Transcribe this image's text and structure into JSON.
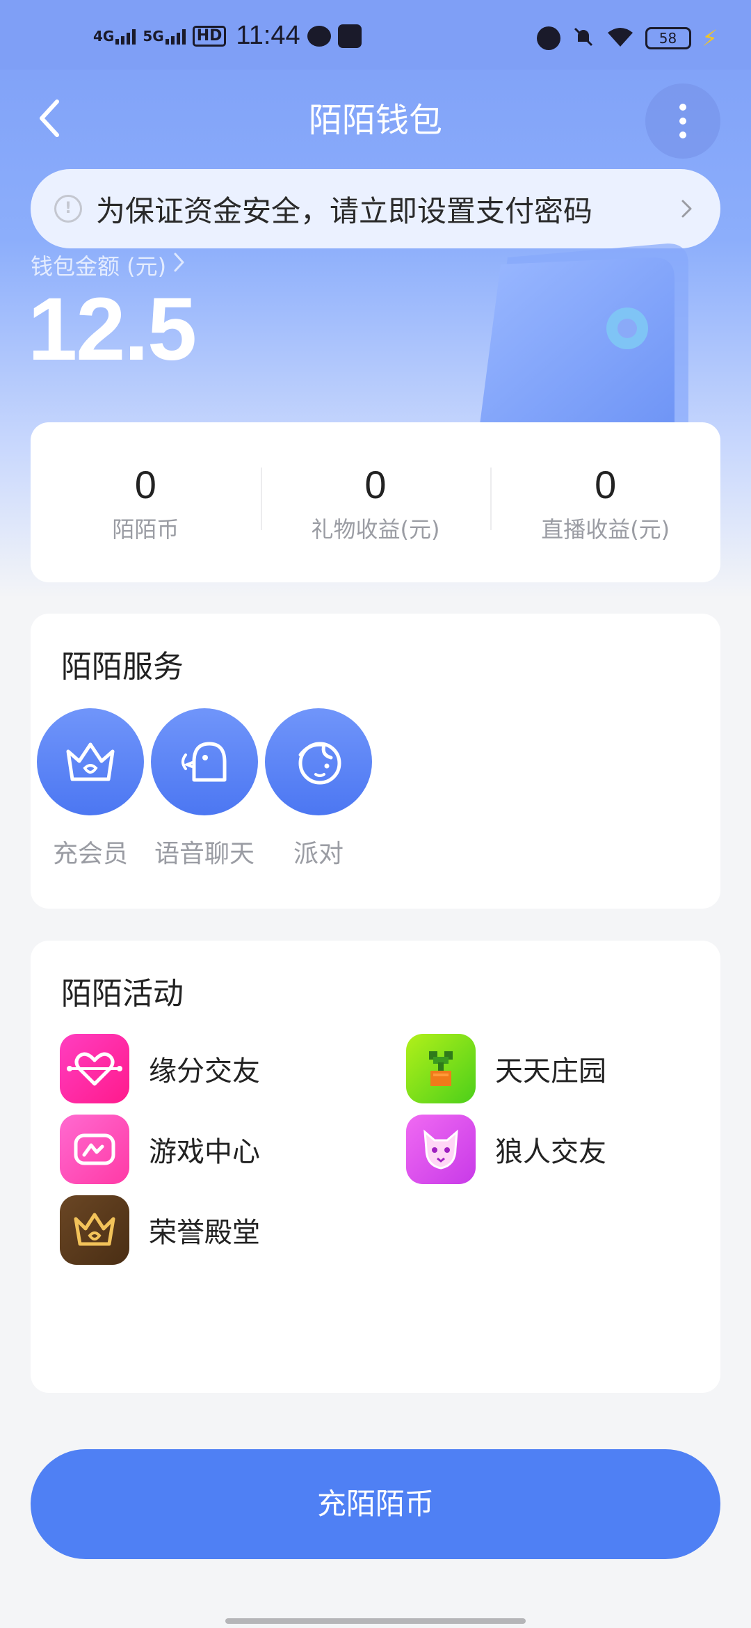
{
  "status_bar": {
    "network_1": "4G",
    "network_2": "5G",
    "hd": "HD",
    "time": "11:44",
    "battery": "58"
  },
  "header": {
    "title": "陌陌钱包"
  },
  "notice": {
    "text": "为保证资金安全，请立即设置支付密码"
  },
  "wallet": {
    "label": "钱包金额 (元)",
    "amount": "12.5"
  },
  "stats": [
    {
      "value": "0",
      "label": "陌陌币"
    },
    {
      "value": "0",
      "label": "礼物收益(元)"
    },
    {
      "value": "0",
      "label": "直播收益(元)"
    }
  ],
  "services": {
    "title": "陌陌服务",
    "items": [
      {
        "label": "充会员",
        "icon": "crown-icon"
      },
      {
        "label": "语音聊天",
        "icon": "voice-chat-icon"
      },
      {
        "label": "派对",
        "icon": "party-icon"
      }
    ]
  },
  "activities": {
    "title": "陌陌活动",
    "items": [
      {
        "label": "缘分交友",
        "icon": "heart-icon",
        "color": "#ff2aa8"
      },
      {
        "label": "天天庄园",
        "icon": "sprout-icon",
        "color": "#7ee01f"
      },
      {
        "label": "游戏中心",
        "icon": "game-icon",
        "color": "#ff4fbf"
      },
      {
        "label": "狼人交友",
        "icon": "wolf-icon",
        "color": "#e54cf2"
      },
      {
        "label": "荣誉殿堂",
        "icon": "crown-gold-icon",
        "color": "#5a3a1c"
      }
    ]
  },
  "footer": {
    "recharge_label": "充陌陌币"
  },
  "colors": {
    "accent": "#4f80f4",
    "hero": "#7d9ef7"
  }
}
